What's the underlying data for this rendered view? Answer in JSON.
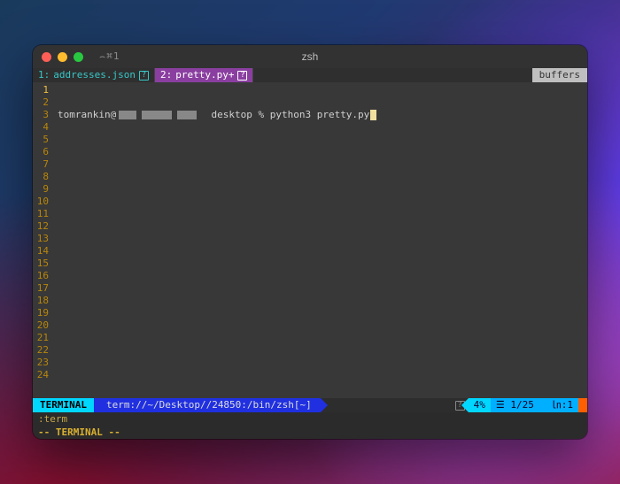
{
  "window": {
    "title": "zsh",
    "tab_indicator": "⌢⌘1"
  },
  "buffers": {
    "items": [
      {
        "index": "1:",
        "name": "addresses.json",
        "active": false
      },
      {
        "index": "2:",
        "name": "pretty.py+",
        "active": true
      }
    ],
    "label": "buffers"
  },
  "terminal": {
    "user": "tomrankin@",
    "path_label": "desktop",
    "prompt_symbol": "%",
    "command": "python3 pretty.py"
  },
  "gutter": {
    "total_lines": 24,
    "current_line": 1
  },
  "status": {
    "mode": "TERMINAL",
    "path": "term://~/Desktop//24850:/bin/zsh[~]",
    "percent": "4%",
    "line_info": "☰ 1/25",
    "col_info": "㏑:1"
  },
  "cmdline": ":term",
  "mode_msg": "-- TERMINAL --"
}
